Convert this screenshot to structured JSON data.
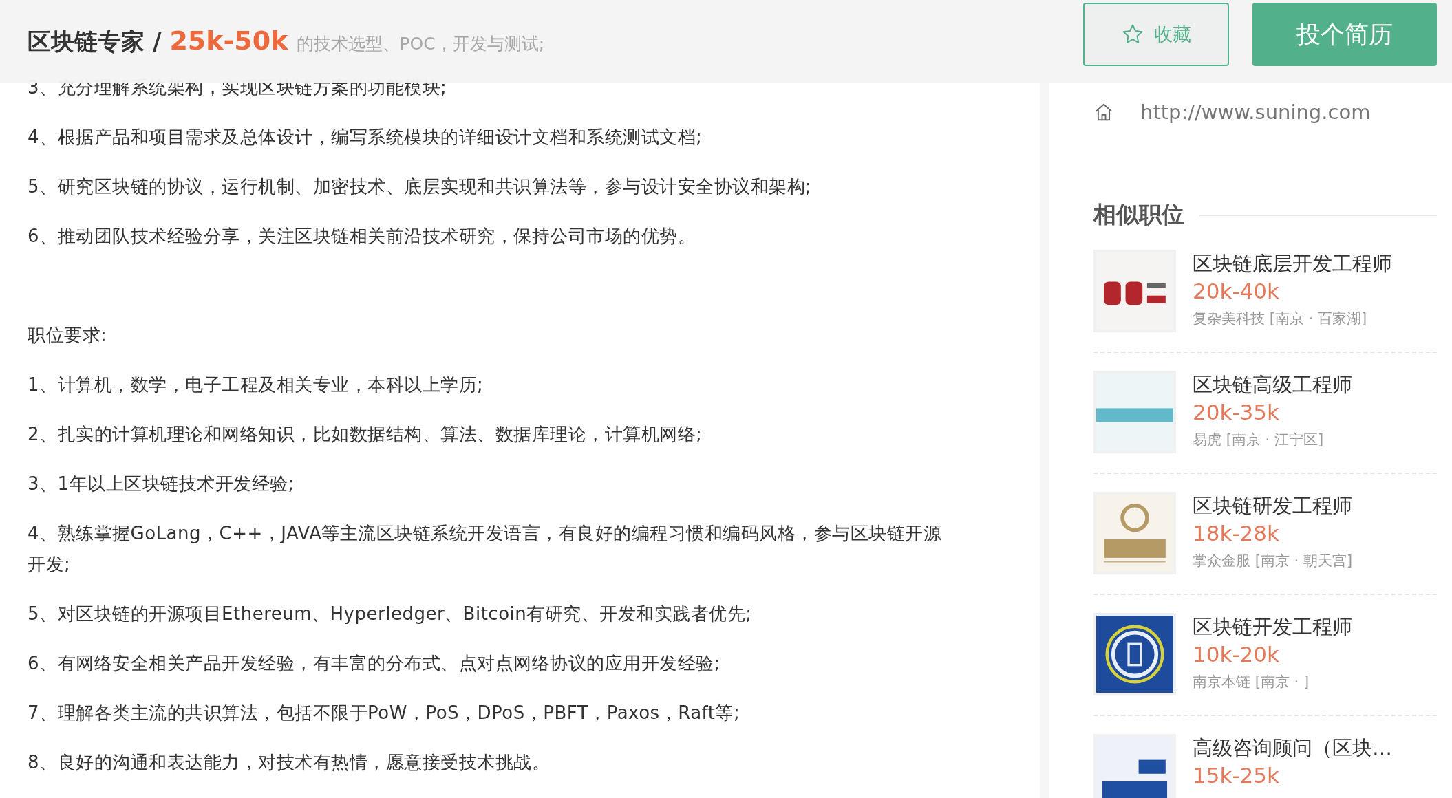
{
  "header": {
    "title": "区块链专家",
    "separator": "/",
    "salary": "25k-50k",
    "faded_text": "的技术选型、POC，开发与测试;",
    "buttons": [
      {
        "kind": "favorite",
        "label": "收藏"
      },
      {
        "kind": "apply",
        "label": "投个简历"
      }
    ]
  },
  "description": {
    "duties": [
      "3、充分理解系统架构，实现区块链方案的功能模块;",
      "4、根据产品和项目需求及总体设计，编写系统模块的详细设计文档和系统测试文档;",
      "5、研究区块链的协议，运行机制、加密技术、底层实现和共识算法等，参与设计安全协议和架构;",
      "6、推动团队技术经验分享，关注区块链相关前沿技术研究，保持公司市场的优势。"
    ],
    "requirements_title": "职位要求:",
    "requirements": [
      "1、计算机，数学，电子工程及相关专业，本科以上学历;",
      "2、扎实的计算机理论和网络知识，比如数据结构、算法、数据库理论，计算机网络;",
      "3、1年以上区块链技术开发经验;",
      "4、熟练掌握GoLang，C++，JAVA等主流区块链系统开发语言，有良好的编程习惯和编码风格，参与区块链开源开发;",
      "5、对区块链的开源项目Ethereum、Hyperledger、Bitcoin有研究、开发和实践者优先;",
      "6、有网络安全相关产品开发经验，有丰富的分布式、点对点网络协议的应用开发经验;",
      "7、理解各类主流的共识算法，包括不限于PoW，PoS，DPoS，PBFT，Paxos，Raft等;",
      "8、良好的沟通和表达能力，对技术有热情，愿意接受技术挑战。"
    ]
  },
  "sidebar": {
    "website": "http://www.suning.com",
    "similar_title": "相似职位",
    "jobs": [
      {
        "title": "区块链底层开发工程师",
        "salary": "20k-40k",
        "company": "复杂美科技 [南京 · 百家湖]"
      },
      {
        "title": "区块链高级工程师",
        "salary": "20k-35k",
        "company": "易虎 [南京 · 江宁区]"
      },
      {
        "title": "区块链研发工程师",
        "salary": "18k-28k",
        "company": "掌众金服 [南京 · 朝天宫]"
      },
      {
        "title": "区块链开发工程师",
        "salary": "10k-20k",
        "company": "南京本链 [南京 · ]"
      },
      {
        "title": "高级咨询顾问（区块…",
        "salary": "15k-25k"
      }
    ]
  }
}
